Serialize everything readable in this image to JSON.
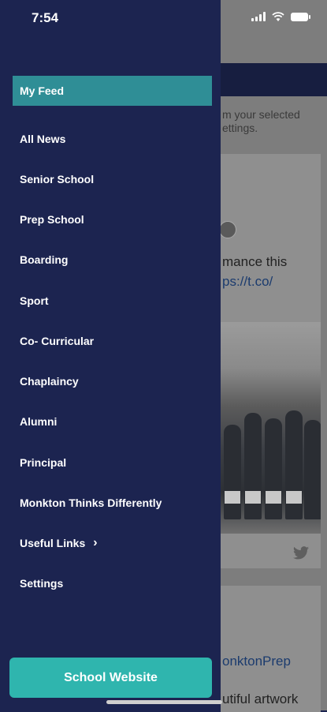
{
  "status_bar": {
    "time": "7:54"
  },
  "background": {
    "notice_text": "m your selected ettings.",
    "tweet_text": "mance this",
    "tweet_link": "ps://t.co/",
    "card2_link": "onktonPrep",
    "card2_text": "utiful artwork"
  },
  "menu": {
    "items": [
      {
        "label": "My Feed",
        "active": true
      },
      {
        "label": "All News"
      },
      {
        "label": "Senior School"
      },
      {
        "label": "Prep School"
      },
      {
        "label": "Boarding"
      },
      {
        "label": "Sport"
      },
      {
        "label": "Co- Curricular"
      },
      {
        "label": "Chaplaincy"
      },
      {
        "label": "Alumni"
      },
      {
        "label": "Principal"
      },
      {
        "label": "Monkton Thinks Differently"
      },
      {
        "label": "Useful Links",
        "chevron": "›"
      },
      {
        "label": "Settings"
      }
    ]
  },
  "school_website_button": "School Website",
  "colors": {
    "drawer": "#1c2450",
    "active_item": "#2f8e96",
    "button": "#2fb5ae"
  }
}
